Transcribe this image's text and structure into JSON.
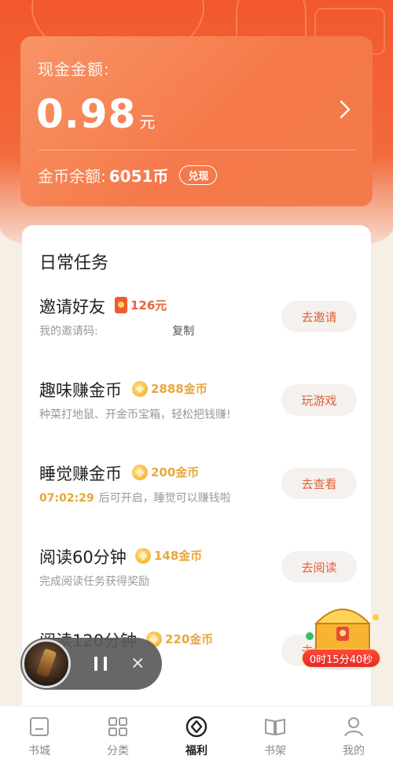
{
  "cash_card": {
    "label": "现金金额:",
    "amount": "0.98",
    "unit": "元",
    "coin_label": "金币余额:",
    "coin_value": "6051币",
    "exchange_label": "兑现"
  },
  "tasks_section": {
    "title": "日常任务",
    "tasks": [
      {
        "name": "邀请好友",
        "reward": "126元",
        "desc": "我的邀请码:",
        "copy_label": "复制",
        "action": "去邀请"
      },
      {
        "name": "趣味赚金币",
        "reward": "2888金币",
        "desc": "种菜打地鼠、开金币宝箱，轻松把钱赚!",
        "action": "玩游戏"
      },
      {
        "name": "睡觉赚金币",
        "reward": "200金币",
        "countdown": "07:02:29",
        "desc": "后可开启，睡觉可以赚钱啦",
        "action": "去查看"
      },
      {
        "name": "阅读60分钟",
        "reward": "148金币",
        "desc": "完成阅读任务获得奖励",
        "action": "去阅读"
      },
      {
        "name": "阅读120分钟",
        "reward": "220金币",
        "desc": "",
        "action": "去阅读"
      }
    ]
  },
  "mini_player": {
    "close_symbol": "×"
  },
  "chest": {
    "timer": "0时15分40秒"
  },
  "bottom_nav": {
    "items": [
      {
        "label": "书城",
        "icon": "bookstore-icon"
      },
      {
        "label": "分类",
        "icon": "category-grid-icon"
      },
      {
        "label": "福利",
        "icon": "welfare-icon"
      },
      {
        "label": "书架",
        "icon": "bookshelf-icon"
      },
      {
        "label": "我的",
        "icon": "profile-icon"
      }
    ],
    "active_index": 2
  },
  "colors": {
    "accent_orange": "#f5794a",
    "coin_gold": "#e8a73a",
    "action_red": "#e0603a"
  }
}
